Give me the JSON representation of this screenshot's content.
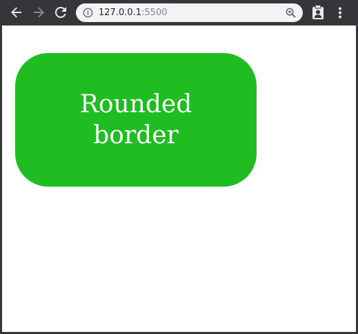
{
  "browser": {
    "url_host": "127.0.0.1",
    "url_port": ":5500",
    "icons": {
      "back": "arrow-left-icon",
      "forward": "arrow-right-icon",
      "reload": "reload-icon",
      "info": "info-icon",
      "zoom": "zoom-in-icon",
      "extension": "clipboard-person-icon",
      "menu": "kebab-menu-icon"
    }
  },
  "page": {
    "box_text": "Rounded border",
    "box_color": "#1fbd22",
    "text_color": "#ffffff",
    "background": "#ffffff"
  }
}
